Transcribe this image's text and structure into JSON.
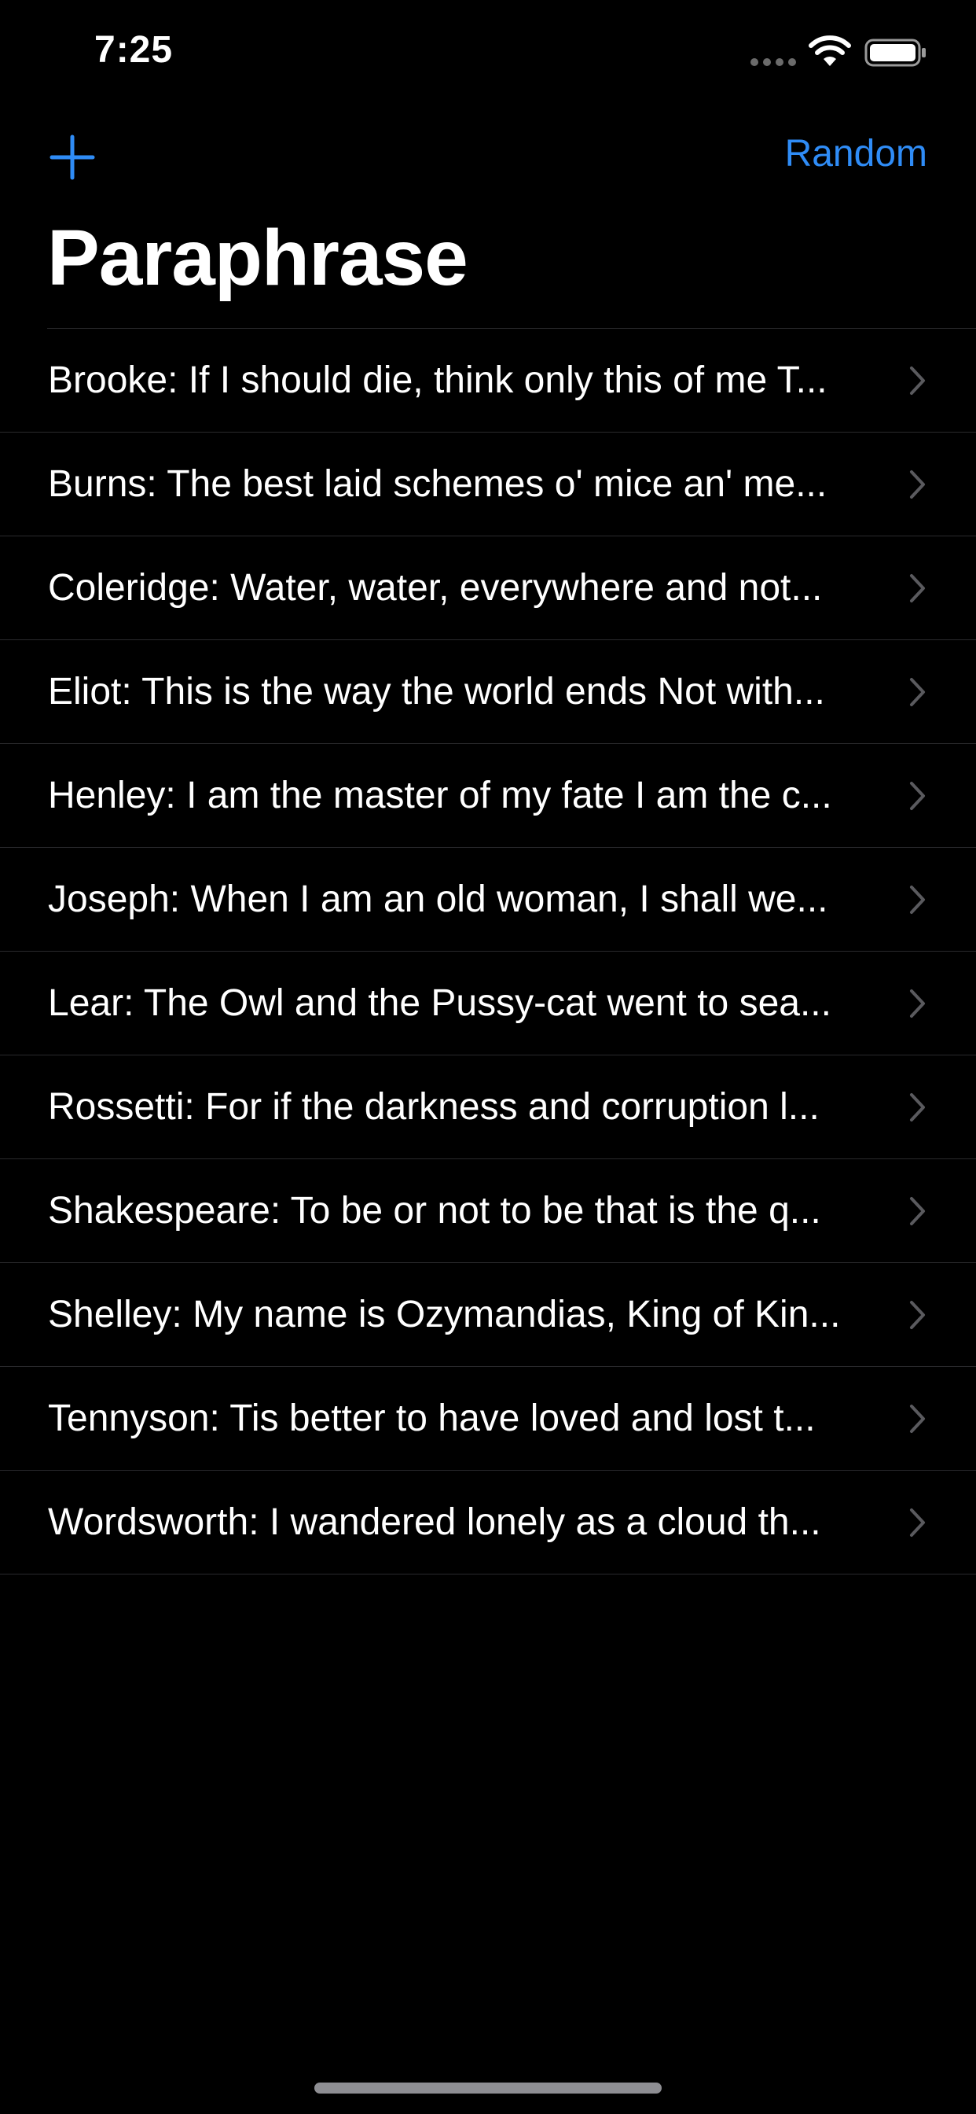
{
  "status_bar": {
    "time": "7:25"
  },
  "nav": {
    "add_icon": "plus-icon",
    "random_label": "Random"
  },
  "title": "Paraphrase",
  "colors": {
    "accent": "#2f8cf6",
    "background": "#000000",
    "separator": "#2a2a2d",
    "chevron": "#5a5a5e"
  },
  "list": {
    "items": [
      {
        "label": "Brooke: If I should die, think only this of me T..."
      },
      {
        "label": "Burns: The best laid schemes o' mice an' me..."
      },
      {
        "label": "Coleridge: Water, water, everywhere and not..."
      },
      {
        "label": "Eliot: This is the way the world ends Not with..."
      },
      {
        "label": "Henley: I am the master of my fate I am the c..."
      },
      {
        "label": "Joseph: When I am an old woman, I shall we..."
      },
      {
        "label": "Lear: The Owl and the Pussy-cat went to sea..."
      },
      {
        "label": "Rossetti: For if the darkness and corruption l..."
      },
      {
        "label": "Shakespeare: To be or not to be that is the q..."
      },
      {
        "label": "Shelley: My name is Ozymandias, King of Kin..."
      },
      {
        "label": "Tennyson: Tis better to have loved and lost t..."
      },
      {
        "label": "Wordsworth: I wandered lonely as a cloud th..."
      }
    ]
  }
}
